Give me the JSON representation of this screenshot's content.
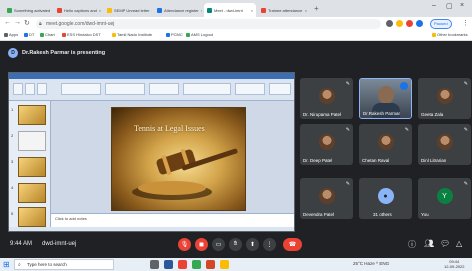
{
  "browser": {
    "tabs": [
      {
        "label": "Something activated",
        "color": "#34a853"
      },
      {
        "label": "Hello captions and",
        "color": "#ea4335"
      },
      {
        "label": "SEMP Unread letter",
        "color": "#fbbc05"
      },
      {
        "label": "Attendance register",
        "color": "#1a73e8"
      },
      {
        "label": "Meet - dwd-imnt",
        "color": "#00897b"
      },
      {
        "label": "Trainee attendance",
        "color": "#ea4335"
      }
    ],
    "url": "meet.google.com/dwd-imnt-uej",
    "profile_label": "Paused",
    "bookmarks": [
      "Apps",
      "DT",
      "Chart",
      "ESS Hindalco DST",
      "Tamil Nadu Institute",
      "PCMC",
      "AMS Logout"
    ],
    "other_bookmarks": "Other bookmarks"
  },
  "meet": {
    "presenting_text": "Dr.Rakesh Parmar is presenting",
    "presenter_initial": "D",
    "slide_title": "Tennis at Legal Issues",
    "notes_placeholder": "Click to add notes",
    "participants": [
      {
        "name": "Dr. Nirupama Patel",
        "kind": "photo"
      },
      {
        "name": "Dr.Rakesh Parmar",
        "kind": "camera"
      },
      {
        "name": "Geeta Zala",
        "kind": "photo"
      },
      {
        "name": "Dr. Deep Patel",
        "kind": "photo"
      },
      {
        "name": "Chetan Raval",
        "kind": "photo"
      },
      {
        "name": "Dinl Litrarian",
        "kind": "photo"
      },
      {
        "name": "Devendra Patel",
        "kind": "photo"
      },
      {
        "name": "31 others",
        "kind": "group"
      },
      {
        "name": "You",
        "kind": "photo"
      }
    ],
    "time": "9:44 AM",
    "meeting_code": "dwd-imnt-uej",
    "accent": "#8ab4f8",
    "hangup_color": "#ea4335"
  },
  "taskbar": {
    "search_placeholder": "Type here to search",
    "tray_text": "25°C Haze ^ ENG",
    "clock_time": "09:44",
    "clock_date": "12-09-2022"
  }
}
